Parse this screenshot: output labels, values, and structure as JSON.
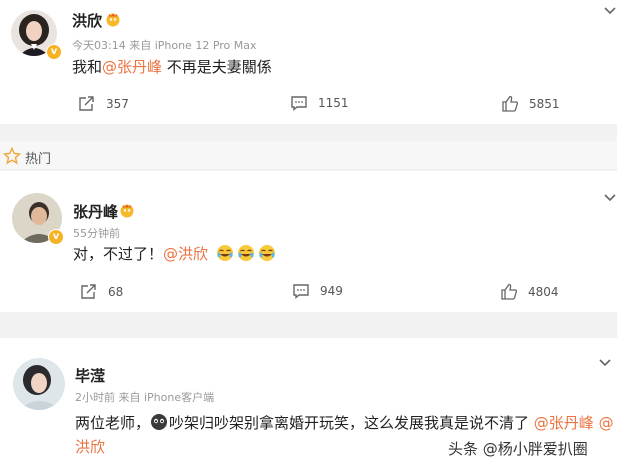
{
  "posts": [
    {
      "author": "洪欣",
      "time": "今天03:14",
      "source": "来自 iPhone 12 Pro Max",
      "text_before": "我和",
      "mention": "@张丹峰",
      "text_after": " 不再是夫妻關係",
      "reposts": "357",
      "comments": "1151",
      "likes": "5851"
    }
  ],
  "hot_section": {
    "label": "热门"
  },
  "comments": [
    {
      "author": "张丹峰",
      "time": "55分钟前",
      "text_before": "对，不过了！",
      "mention": "@洪欣",
      "reposts": "68",
      "comments": "949",
      "likes": "4804"
    },
    {
      "author": "毕滢",
      "time": "2小时前",
      "source": "来自 iPhone客户端",
      "line1_before": "两位老师，",
      "line1_middle": "吵架归吵架别拿离婚开玩笑，这么发展我真是说不清了 ",
      "mention1": "@张丹峰",
      "mention2_part1": "@",
      "mention2_part2": "洪欣"
    }
  ],
  "watermark": "头条 @杨小胖爱扒圈",
  "colors": {
    "mention": "#eb7340",
    "badge": "#f6b221",
    "meta": "#999999"
  }
}
